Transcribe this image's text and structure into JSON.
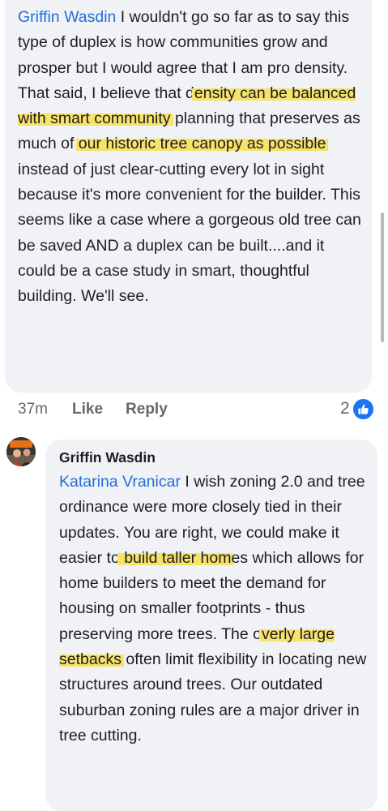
{
  "comment1": {
    "author": "Griffin Wasdin",
    "text_1": " I wouldn't go so far as to say this type of duplex is how communities grow and prosper but I would agree that I am pro density. That said, I believe that d",
    "highlight_1": "ensity can be",
    "text_2": " ",
    "highlight_2": "balanced with smart community",
    "text_3": " planning that preserves as much of ",
    "highlight_3": "our historic tree canopy as possible",
    "text_4": " instead of just clear-cutting every lot in sight because it's more convenient for the builder. This seems like a case where a gorgeous old tree can be saved AND a duplex can be built....and it could be a case study in smart, thoughtful building. We'll see."
  },
  "actions": {
    "time": "37m",
    "like": "Like",
    "reply": "Reply",
    "reaction_count": "2",
    "reaction_icon": "thumbs-up-icon",
    "reaction_color": "#1877f2"
  },
  "comment2": {
    "author": "Griffin Wasdin",
    "mention": "Katarina Vranicar",
    "text_1": " I wish zoning 2.0 and tree ordinance were more closely tied in their updates. You are right, we could make it easier to",
    "highlight_1": " build taller hom",
    "text_2": "es which allows for home builders to meet the demand for housing on smaller footprints - thus preserving more trees. The o",
    "highlight_2": "verly large setbacks",
    "text_3": " often limit flexibility in locating new structures around trees. Our outdated suburban zoning rules are a major driver in tree cutting."
  },
  "colors": {
    "link": "#216fdb",
    "highlight": "#f7e26a",
    "bubble": "#f0f2f5",
    "meta_text": "#65676b"
  }
}
